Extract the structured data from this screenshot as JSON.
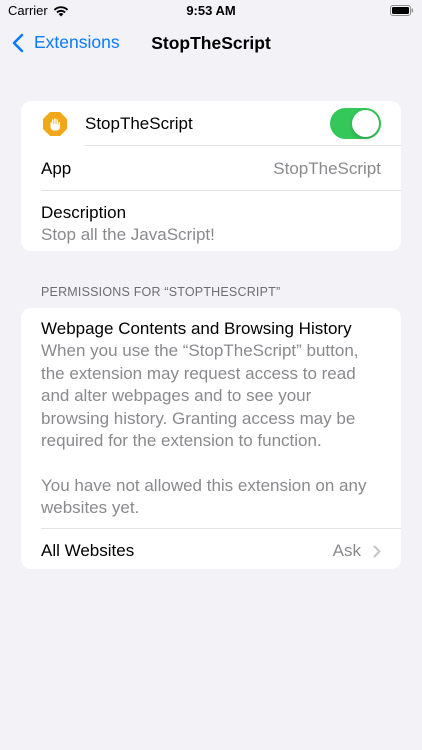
{
  "status_bar": {
    "carrier": "Carrier",
    "time": "9:53 AM"
  },
  "nav": {
    "back_label": "Extensions",
    "title": "StopTheScript"
  },
  "extension": {
    "name": "StopTheScript",
    "icon": "stop-hand-icon",
    "icon_color": "#f2a71b",
    "enabled": true,
    "toggle_color": "#34c759"
  },
  "info": {
    "app_label": "App",
    "app_value": "StopTheScript",
    "description_label": "Description",
    "description_value": "Stop all the JavaScript!"
  },
  "permissions": {
    "section_header": "PERMISSIONS FOR “STOPTHESCRIPT”",
    "title": "Webpage Contents and Browsing History",
    "body": "When you use the “StopTheScript” button, the extension may request access to read and alter webpages and to see your browsing history. Granting access may be required for the extension to function.",
    "note": "You have not allowed this extension on any websites yet.",
    "all_websites_label": "All Websites",
    "all_websites_value": "Ask"
  },
  "colors": {
    "accent": "#0a7aff",
    "secondary_text": "#8a8a8e",
    "background": "#f2f2f7"
  }
}
